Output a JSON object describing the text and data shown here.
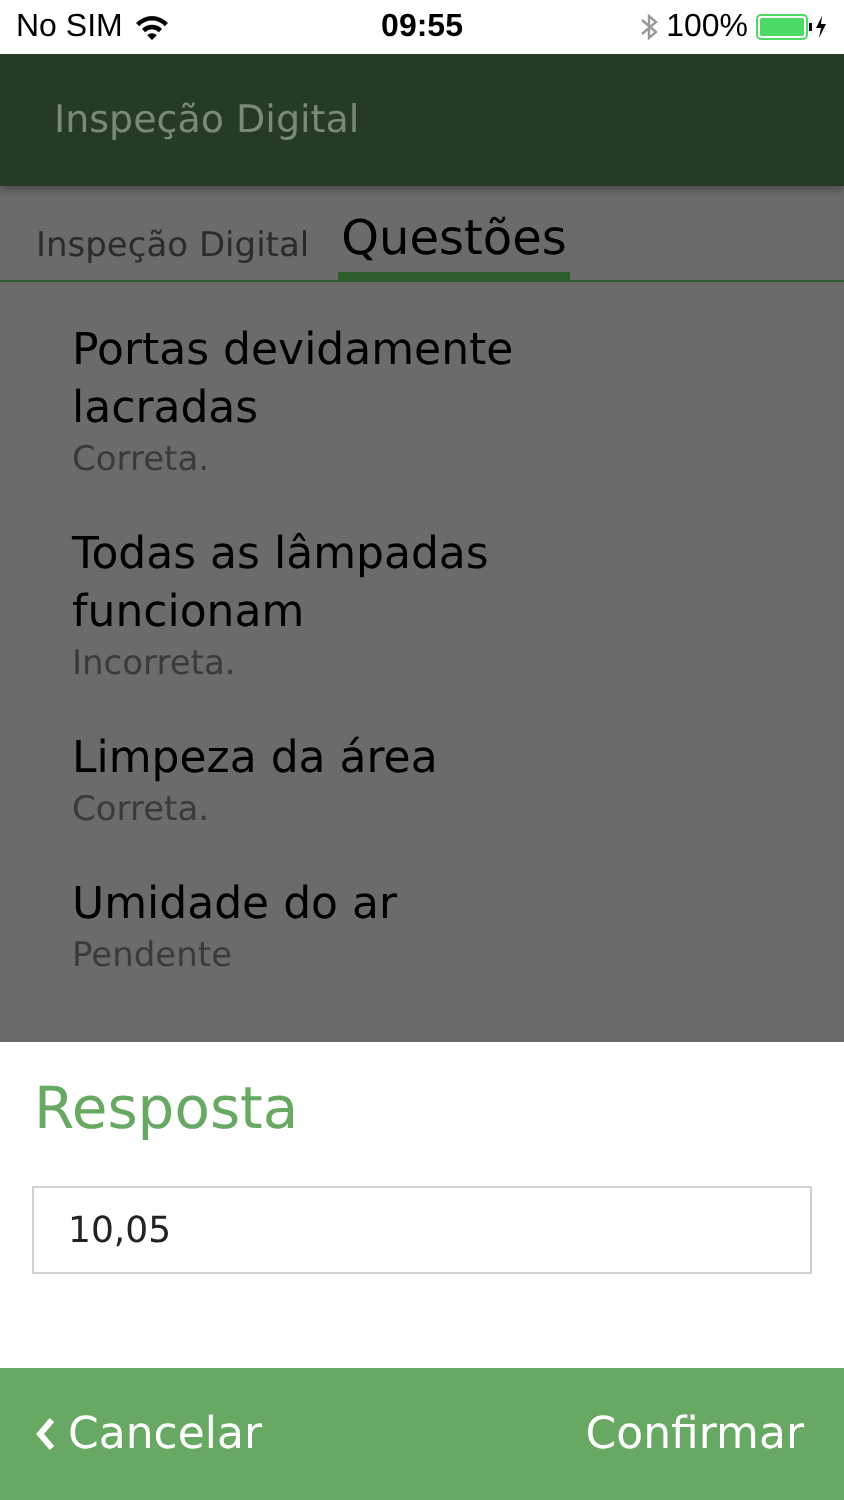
{
  "status_bar": {
    "carrier": "No SIM",
    "time": "09:55",
    "battery": "100%"
  },
  "app_bar": {
    "title": "Inspeção Digital"
  },
  "tabs": [
    {
      "label": "Inspeção Digital",
      "selected": false
    },
    {
      "label": "Questões",
      "selected": true
    }
  ],
  "questions": [
    {
      "title": "Portas devidamente lacradas",
      "status": "Correta."
    },
    {
      "title": "Todas as lâmpadas funcionam",
      "status": "Incorreta."
    },
    {
      "title": "Limpeza da área",
      "status": "Correta."
    },
    {
      "title": "Umidade do ar",
      "status": "Pendente"
    }
  ],
  "dialog": {
    "title": "Resposta",
    "value": "10,05",
    "cancel": "Cancelar",
    "confirm": "Confirmar"
  }
}
